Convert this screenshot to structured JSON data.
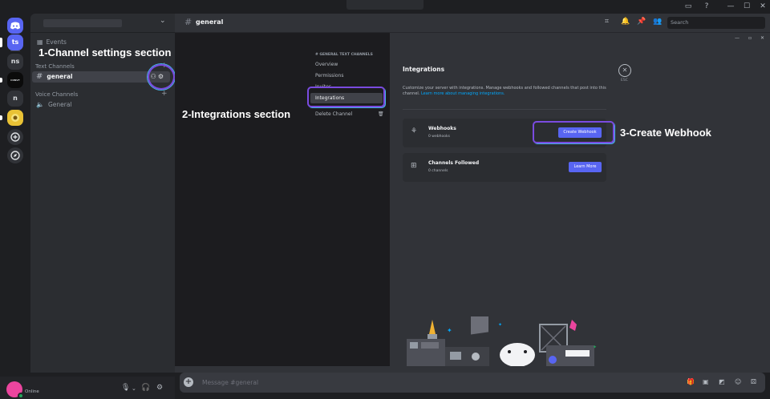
{
  "window": {
    "controls": [
      "▭",
      "?",
      "—",
      "☐",
      "✕"
    ]
  },
  "rail": {
    "servers": [
      {
        "label": "ts"
      },
      {
        "label": "ns"
      },
      {
        "label": "CONVT"
      },
      {
        "label": "n"
      }
    ]
  },
  "sidebar": {
    "events_label": "Events",
    "text_category": "Text Channels",
    "voice_category": "Voice Channels",
    "text_channel": "general",
    "voice_channel": "General"
  },
  "user": {
    "status": "Online"
  },
  "header": {
    "channel": "general",
    "search_placeholder": "Search"
  },
  "settings": {
    "category": "# GENERAL TEXT CHANNELS",
    "nav": [
      "Overview",
      "Permissions",
      "Invites",
      "Integrations",
      "Delete Channel"
    ],
    "page_title": "Integrations",
    "description": "Customize your server with integrations. Manage webhooks and followed channels that post into this channel.",
    "learn_link": "Learn more about managing integrations.",
    "esc_label": "ESC",
    "webhooks": {
      "title": "Webhooks",
      "count": "0 webhooks",
      "button": "Create Webhook"
    },
    "followed": {
      "title": "Channels Followed",
      "count": "0 channels",
      "button": "Learn More"
    }
  },
  "annotations": {
    "step1": "1-Channel settings section",
    "step2": "2-Integrations section",
    "step3": "3-Create Webhook"
  },
  "composer": {
    "placeholder": "Message #general"
  },
  "colors": {
    "blurple": "#5865f2",
    "highlight": "#7a4be0",
    "highlight_outer": "#46b1e6",
    "online": "#23a55a"
  }
}
